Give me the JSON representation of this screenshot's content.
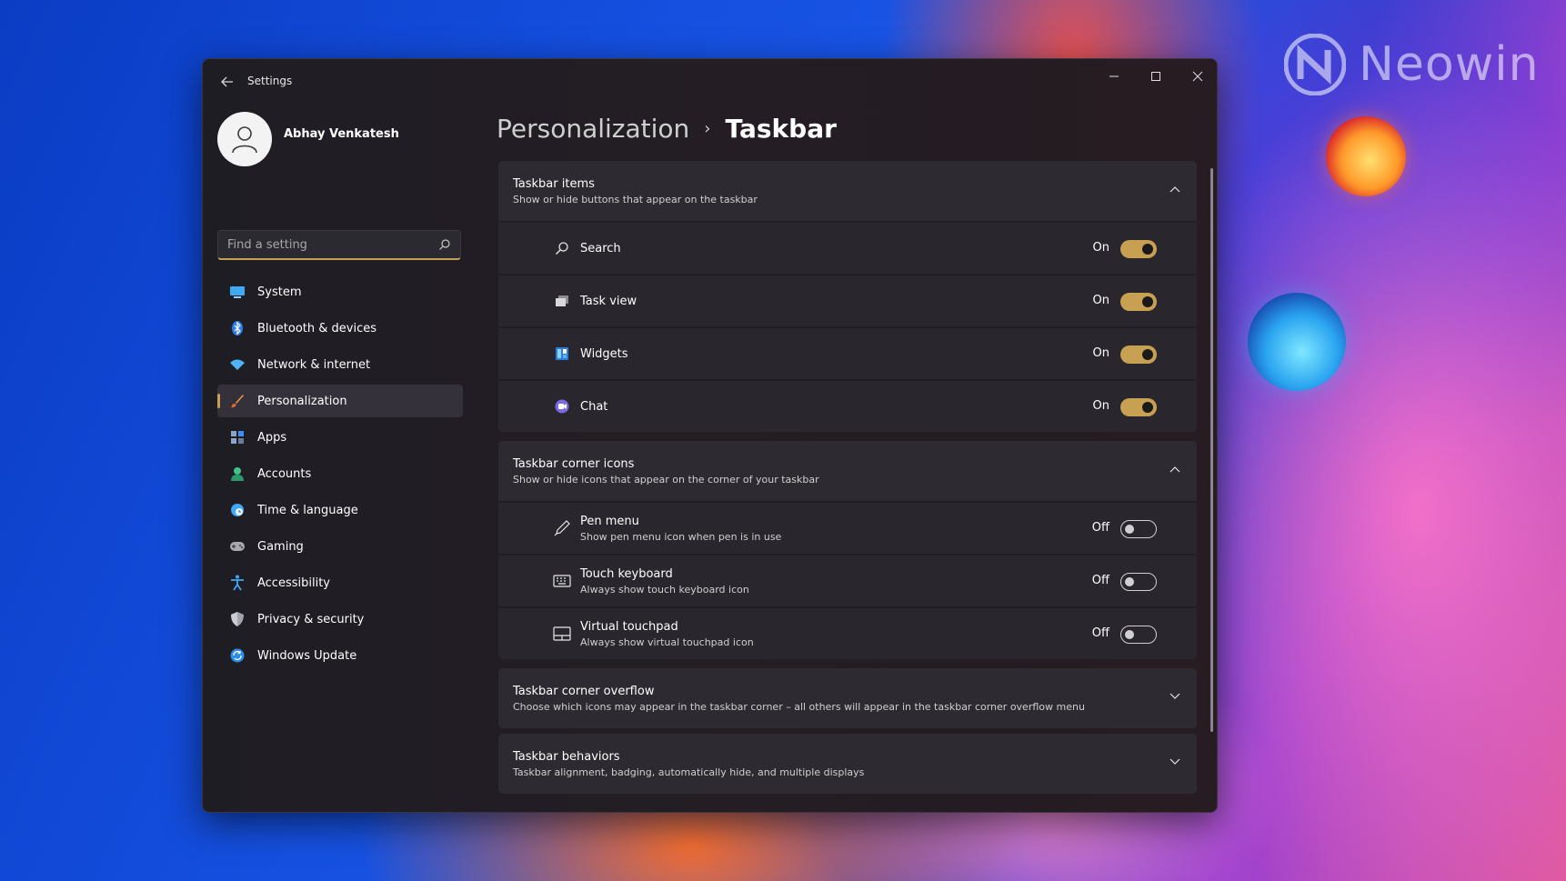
{
  "watermark": {
    "brand": "Neowin"
  },
  "window": {
    "title": "Settings",
    "back_icon": "arrow-left-icon",
    "controls": [
      "minimize-icon",
      "maximize-icon",
      "close-icon"
    ]
  },
  "profile": {
    "name": "Abhay Venkatesh"
  },
  "search": {
    "placeholder": "Find a setting",
    "value": ""
  },
  "nav": {
    "items": [
      {
        "label": "System",
        "icon": "monitor-icon"
      },
      {
        "label": "Bluetooth & devices",
        "icon": "bluetooth-icon"
      },
      {
        "label": "Network & internet",
        "icon": "wifi-icon"
      },
      {
        "label": "Personalization",
        "icon": "brush-icon",
        "active": true
      },
      {
        "label": "Apps",
        "icon": "apps-icon"
      },
      {
        "label": "Accounts",
        "icon": "person-icon"
      },
      {
        "label": "Time & language",
        "icon": "globe-clock-icon"
      },
      {
        "label": "Gaming",
        "icon": "gamepad-icon"
      },
      {
        "label": "Accessibility",
        "icon": "accessibility-icon"
      },
      {
        "label": "Privacy & security",
        "icon": "shield-icon"
      },
      {
        "label": "Windows Update",
        "icon": "update-icon"
      }
    ]
  },
  "breadcrumb": {
    "parent": "Personalization",
    "separator": "›",
    "current": "Taskbar"
  },
  "colors": {
    "accent": "#c8a052",
    "window_bg": "#211c24",
    "card_bg": "#2d2930"
  },
  "sections": {
    "taskbar_items": {
      "title": "Taskbar items",
      "subtitle": "Show or hide buttons that appear on the taskbar",
      "expanded": true,
      "rows": [
        {
          "label": "Search",
          "state": "On",
          "icon": "search-icon"
        },
        {
          "label": "Task view",
          "state": "On",
          "icon": "task-view-icon"
        },
        {
          "label": "Widgets",
          "state": "On",
          "icon": "widgets-icon"
        },
        {
          "label": "Chat",
          "state": "On",
          "icon": "chat-icon"
        }
      ]
    },
    "corner_icons": {
      "title": "Taskbar corner icons",
      "subtitle": "Show or hide icons that appear on the corner of your taskbar",
      "expanded": true,
      "rows": [
        {
          "label": "Pen menu",
          "sub": "Show pen menu icon when pen is in use",
          "state": "Off",
          "icon": "pen-icon"
        },
        {
          "label": "Touch keyboard",
          "sub": "Always show touch keyboard icon",
          "state": "Off",
          "icon": "keyboard-icon"
        },
        {
          "label": "Virtual touchpad",
          "sub": "Always show virtual touchpad icon",
          "state": "Off",
          "icon": "touchpad-icon"
        }
      ]
    },
    "corner_overflow": {
      "title": "Taskbar corner overflow",
      "subtitle": "Choose which icons may appear in the taskbar corner – all others will appear in the taskbar corner overflow menu",
      "expanded": false
    },
    "behaviors": {
      "title": "Taskbar behaviors",
      "subtitle": "Taskbar alignment, badging, automatically hide, and multiple displays",
      "expanded": false
    }
  }
}
